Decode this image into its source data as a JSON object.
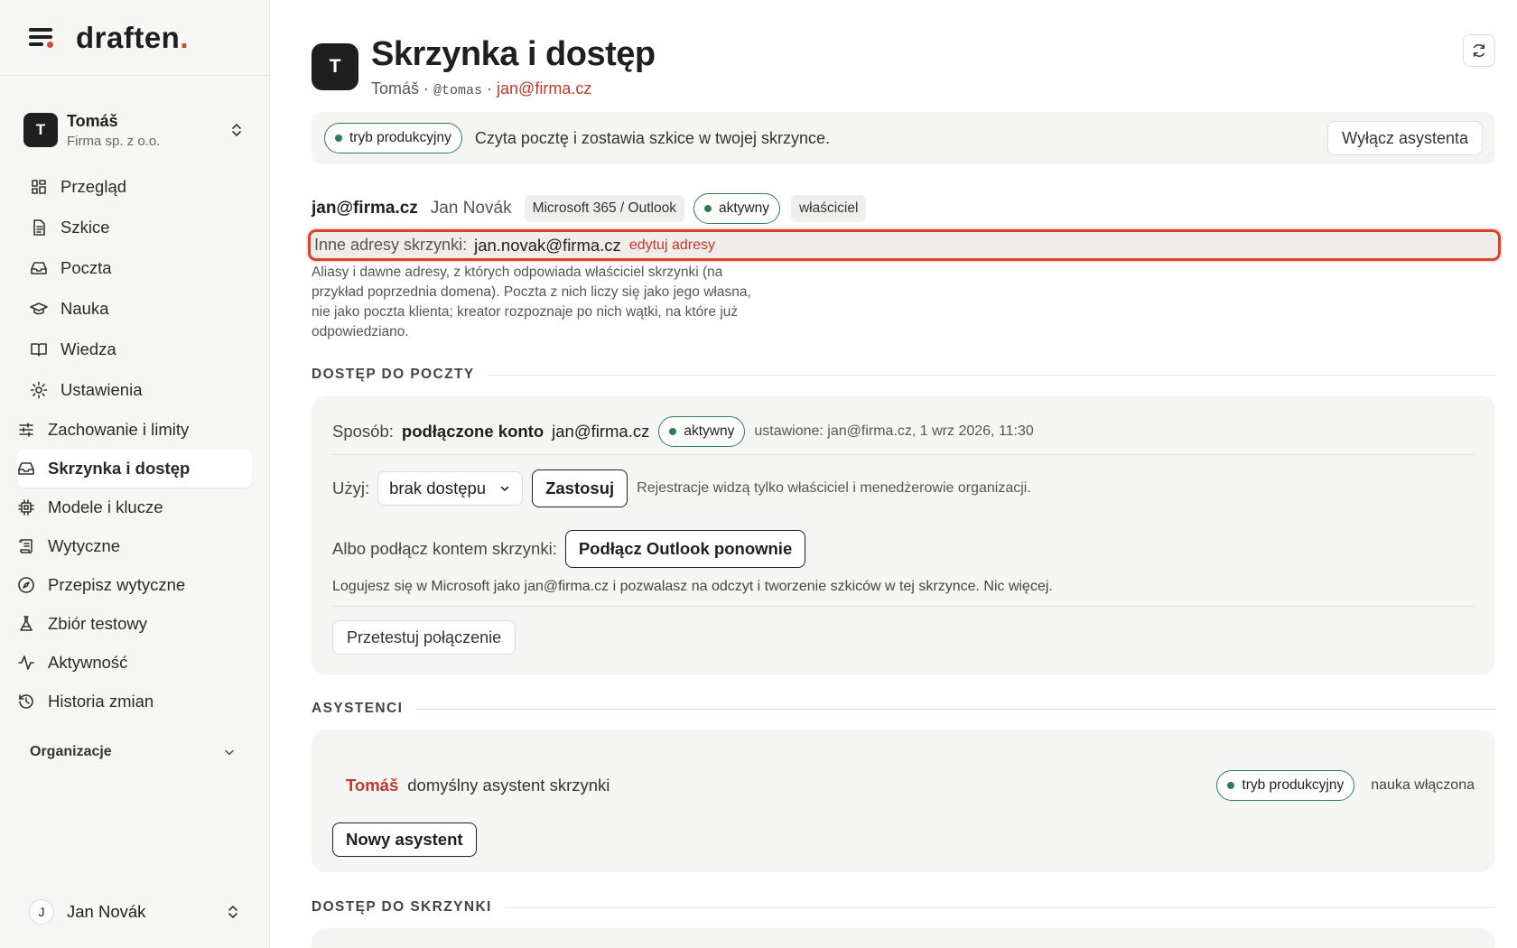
{
  "sidebar": {
    "logo": "draften",
    "logo_dot": ".",
    "org": {
      "avatar": "T",
      "name": "Tomáš",
      "sub": "Firma sp. z o.o."
    },
    "nav": [
      {
        "label": "Przegląd",
        "icon": "grid-icon"
      },
      {
        "label": "Szkice",
        "icon": "document-icon"
      },
      {
        "label": "Poczta",
        "icon": "inbox-icon"
      },
      {
        "label": "Nauka",
        "icon": "graduation-cap-icon"
      },
      {
        "label": "Wiedza",
        "icon": "book-icon"
      },
      {
        "label": "Ustawienia",
        "icon": "gear-icon"
      }
    ],
    "settings_sub": [
      {
        "label": "Zachowanie i limity",
        "icon": "sliders-icon"
      },
      {
        "label": "Skrzynka i dostęp",
        "icon": "inbox-icon",
        "active": true
      },
      {
        "label": "Modele i klucze",
        "icon": "chip-icon"
      },
      {
        "label": "Wytyczne",
        "icon": "scroll-icon"
      },
      {
        "label": "Przepisz wytyczne",
        "icon": "compass-icon"
      },
      {
        "label": "Zbiór testowy",
        "icon": "flask-icon"
      },
      {
        "label": "Aktywność",
        "icon": "activity-icon"
      },
      {
        "label": "Historia zmian",
        "icon": "history-icon"
      }
    ],
    "org_section": "Organizacje",
    "user": {
      "avatar": "J",
      "name": "Jan Novák"
    }
  },
  "header": {
    "avatar": "T",
    "title": "Skrzynka i dostęp",
    "sub_name": "Tomáš",
    "sep1": " · ",
    "handle": "@tomas",
    "sep2": " · ",
    "email": "jan@firma.cz"
  },
  "banner": {
    "mode": "tryb produkcyjny",
    "text": "Czyta pocztę i zostawia szkice w twojej skrzynce.",
    "button": "Wyłącz asystenta"
  },
  "account": {
    "email": "jan@firma.cz",
    "name": "Jan Novák",
    "provider": "Microsoft 365 / Outlook",
    "status": "aktywny",
    "role": "właściciel"
  },
  "aliases": {
    "label": "Inne adresy skrzynki:",
    "value": "jan.novak@firma.cz",
    "edit": "edytuj adresy",
    "help": "Aliasy i dawne adresy, z których odpowiada właściciel skrzynki (na przykład poprzednia domena). Poczta z nich liczy się jako jego własna, nie jako poczta klienta; kreator rozpoznaje po nich wątki, na które już odpowiedziano."
  },
  "mail_access": {
    "heading": "DOSTĘP DO POCZTY",
    "method_label": "Sposób:",
    "method": "podłączone konto",
    "method_email": "jan@firma.cz",
    "status": "aktywny",
    "set_info": "ustawione: jan@firma.cz, 1 wrz 2026, 11:30",
    "use_label": "Użyj:",
    "use_value": "brak dostępu",
    "apply": "Zastosuj",
    "use_note": "Rejestracje widzą tylko właściciel i menedżerowie organizacji.",
    "connect_label": "Albo podłącz kontem skrzynki:",
    "connect_button": "Podłącz Outlook ponownie",
    "connect_note": "Logujesz się w Microsoft jako jan@firma.cz i pozwalasz na odczyt i tworzenie szkiców w tej skrzynce. Nic więcej.",
    "test_button": "Przetestuj połączenie"
  },
  "assistants": {
    "heading": "ASYSTENCI",
    "name": "Tomáš",
    "desc": "domyślny asystent skrzynki",
    "mode": "tryb produkcyjny",
    "learning": "nauka włączona",
    "new_button": "Nowy asystent"
  },
  "mailbox_access": {
    "heading": "DOSTĘP DO SKRZYNKI"
  },
  "colors": {
    "accent": "#d14a2e",
    "green": "#2e7d4f",
    "link_red": "#c0392b"
  }
}
